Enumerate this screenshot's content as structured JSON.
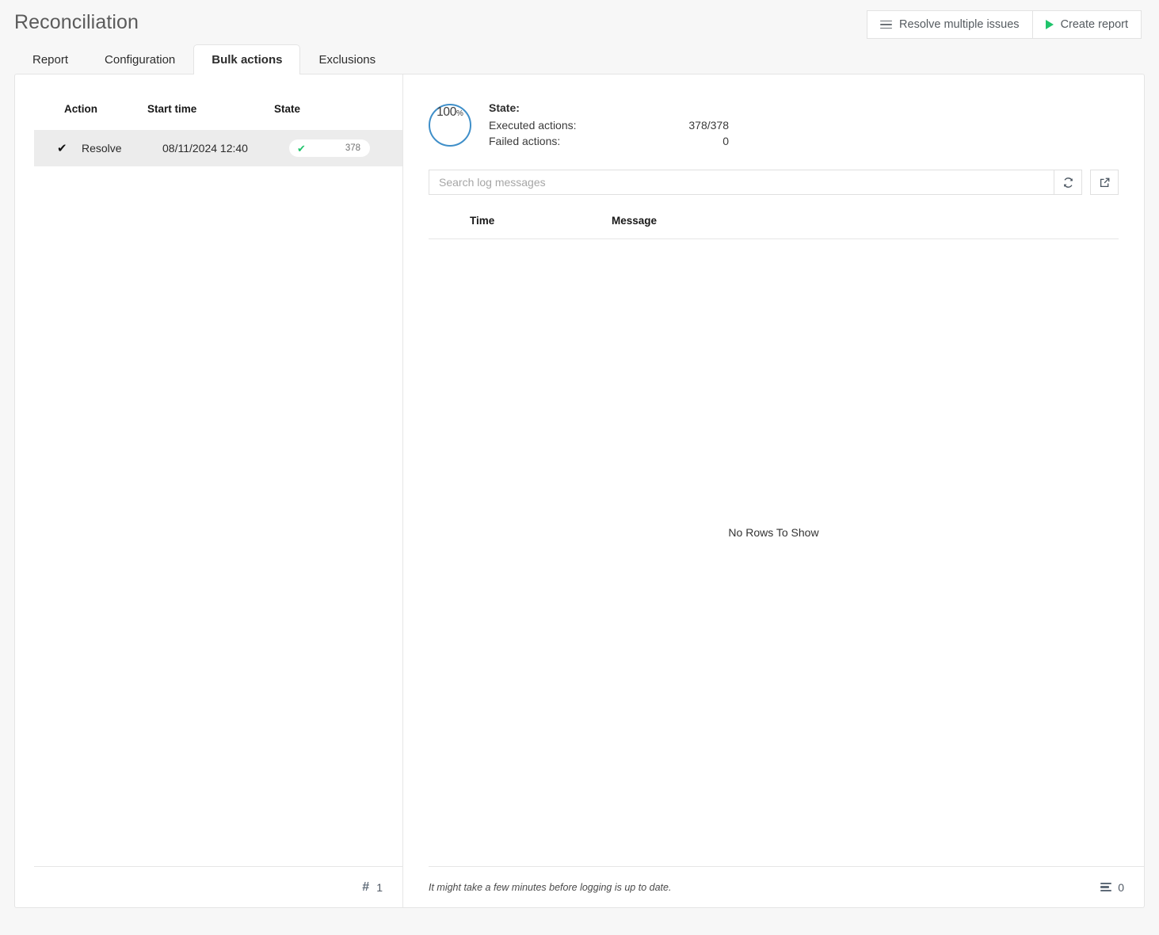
{
  "header": {
    "title": "Reconciliation",
    "actions": [
      {
        "label": "Resolve multiple issues",
        "icon": "hamburger-icon"
      },
      {
        "label": "Create report",
        "icon": "play-icon"
      }
    ]
  },
  "tabs": [
    {
      "label": "Report",
      "active": false
    },
    {
      "label": "Configuration",
      "active": false
    },
    {
      "label": "Bulk actions",
      "active": true
    },
    {
      "label": "Exclusions",
      "active": false
    }
  ],
  "actions_grid": {
    "columns": [
      "Action",
      "Start time",
      "State"
    ],
    "rows": [
      {
        "selected": true,
        "check_icon": "check-icon",
        "action": "Resolve",
        "start_time": "08/11/2024 12:40",
        "state_icon": "check-icon",
        "state_count": "378"
      }
    ],
    "footer": {
      "count_icon": "hash-icon",
      "count": "1"
    }
  },
  "detail": {
    "progress": {
      "value": "100",
      "unit": "%",
      "ring_color": "#3f8fc9"
    },
    "state_title": "State:",
    "stats": [
      {
        "label": "Executed actions:",
        "value": "378/378"
      },
      {
        "label": "Failed actions:",
        "value": "0"
      }
    ],
    "search": {
      "placeholder": "Search log messages",
      "value": "",
      "refresh_icon": "refresh-icon",
      "open_external_icon": "external-link-icon"
    },
    "log_grid": {
      "columns": [
        "Time",
        "Message"
      ],
      "empty_message": "No Rows To Show",
      "rows": []
    },
    "footer": {
      "note": "It might take a few minutes before logging is up to date.",
      "rows_icon": "rows-icon",
      "rows_count": "0"
    }
  },
  "colors": {
    "accent_blue": "#3f8fc9",
    "success_green": "#1fc46b",
    "page_background": "#f7f7f7",
    "panel_background": "#ffffff",
    "selected_row": "#ececec"
  }
}
